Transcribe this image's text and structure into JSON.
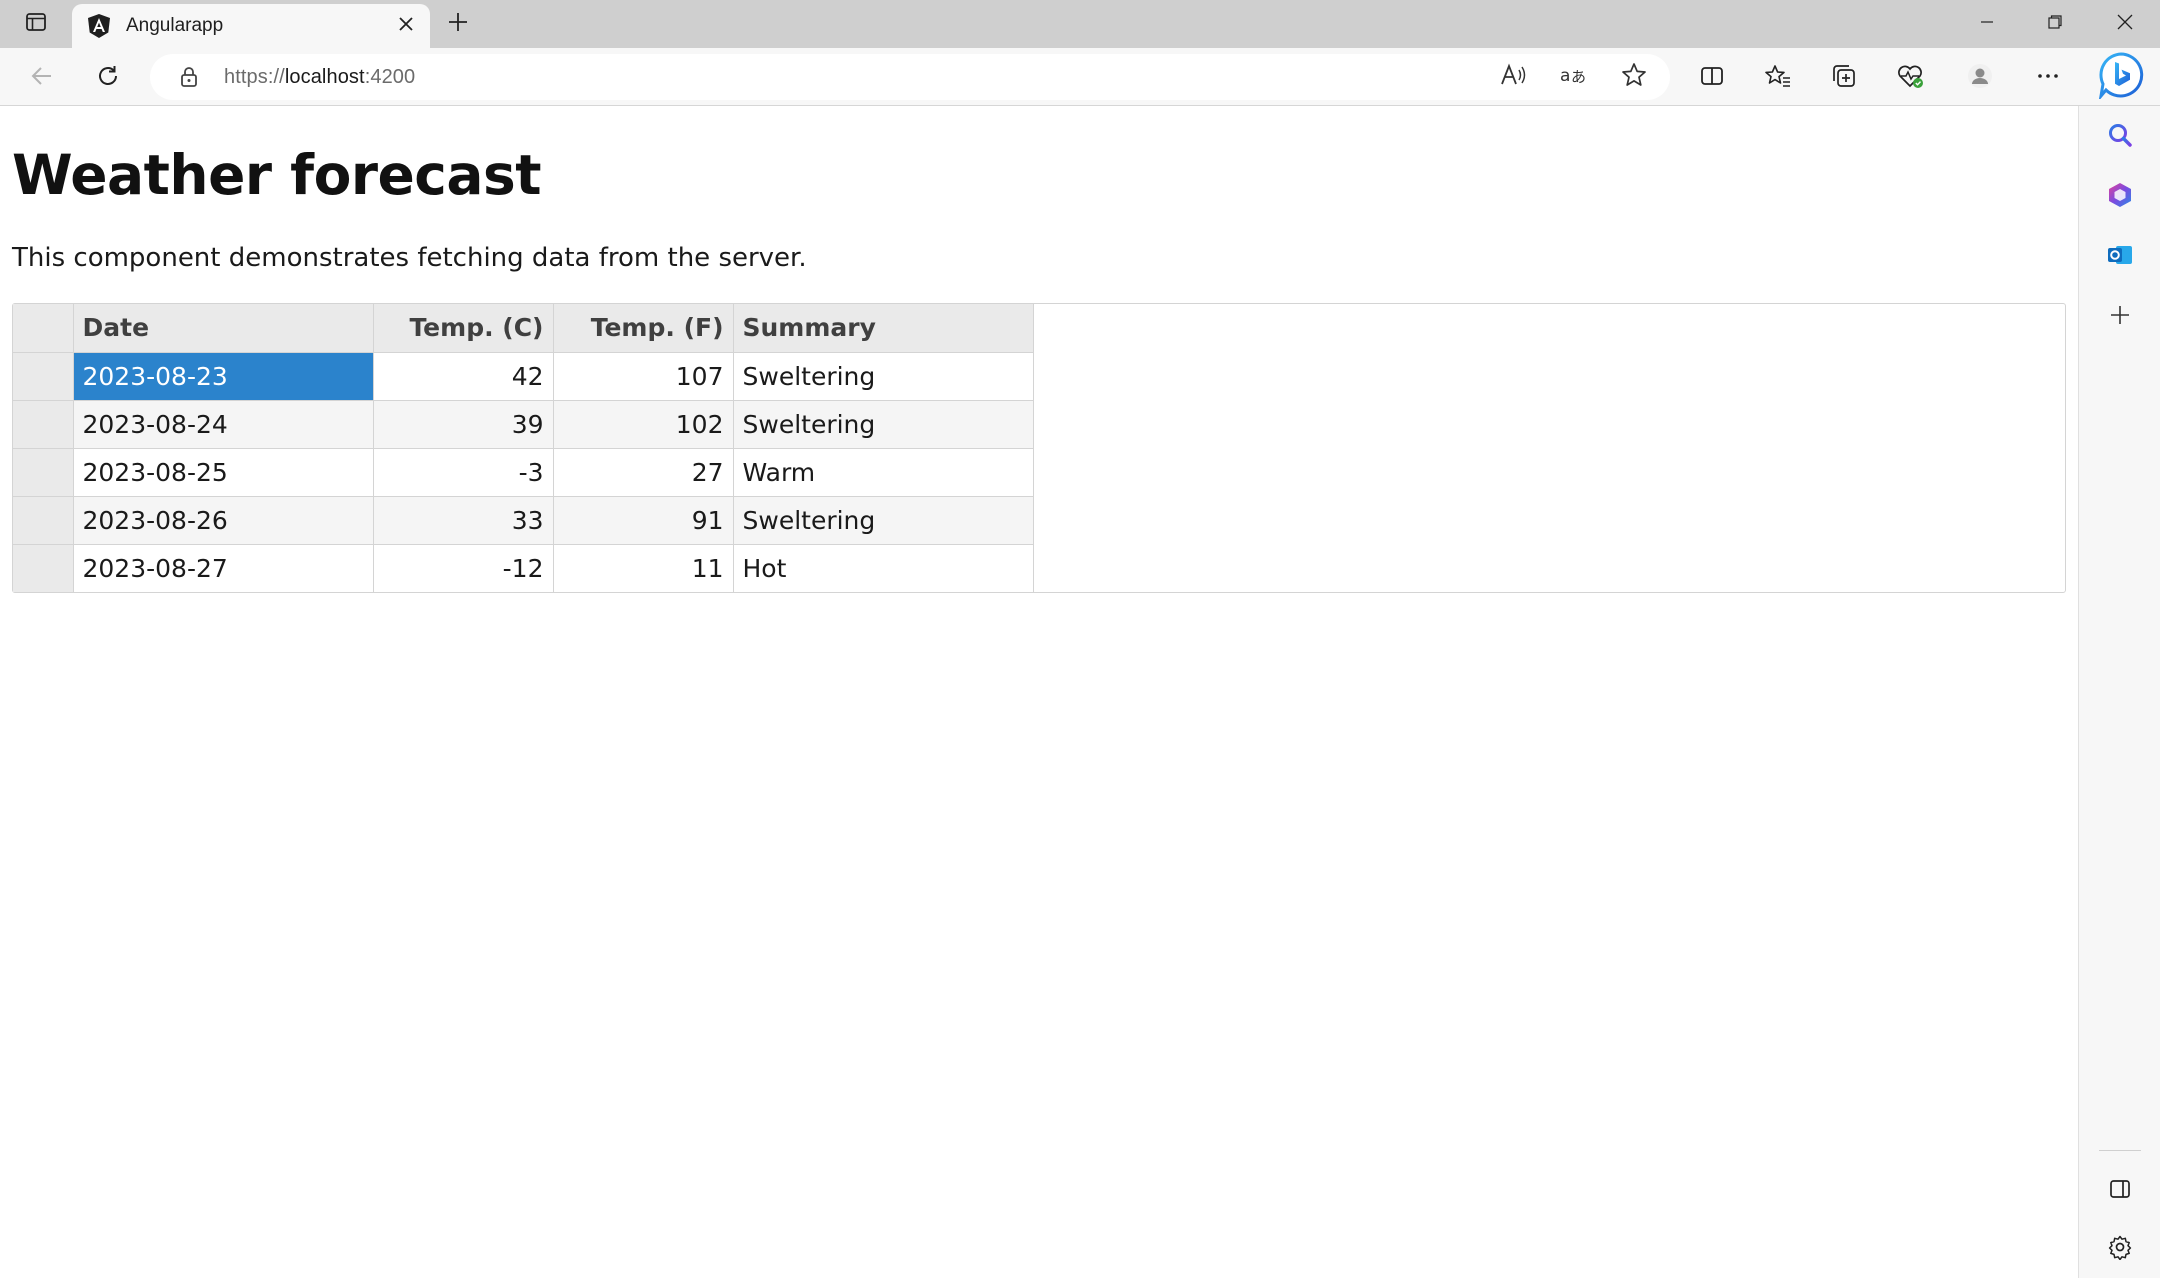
{
  "browser": {
    "tab": {
      "title": "Angularapp",
      "favicon": "angular-logo-icon"
    },
    "address_bar": {
      "scheme": "https://",
      "host": "localhost",
      "port": ":4200"
    },
    "toolbar_icons": [
      "back-icon",
      "refresh-icon",
      "read-aloud-icon",
      "translate-icon",
      "favorite-star-icon",
      "split-screen-icon",
      "favorites-icon",
      "collections-icon",
      "browser-essentials-icon",
      "profile-icon",
      "more-icon"
    ],
    "sidebar_icons": [
      "bing-copilot-icon",
      "search-icon",
      "office-icon",
      "outlook-icon",
      "add-icon",
      "hide-sidebar-icon",
      "settings-icon"
    ],
    "colors": {
      "tab_strip": "#cfcfcf",
      "toolbar": "#f7f7f7",
      "selection": "#2b83cc"
    }
  },
  "page": {
    "title": "Weather forecast",
    "description": "This component demonstrates fetching data from the server."
  },
  "grid": {
    "columns": [
      "Date",
      "Temp. (C)",
      "Temp. (F)",
      "Summary"
    ],
    "rows": [
      {
        "date": "2023-08-23",
        "temp_c": "42",
        "temp_f": "107",
        "summary": "Sweltering"
      },
      {
        "date": "2023-08-24",
        "temp_c": "39",
        "temp_f": "102",
        "summary": "Sweltering"
      },
      {
        "date": "2023-08-25",
        "temp_c": "-3",
        "temp_f": "27",
        "summary": "Warm"
      },
      {
        "date": "2023-08-26",
        "temp_c": "33",
        "temp_f": "91",
        "summary": "Sweltering"
      },
      {
        "date": "2023-08-27",
        "temp_c": "-12",
        "temp_f": "11",
        "summary": "Hot"
      }
    ],
    "selected_cell": {
      "row": 0,
      "column": "Date"
    }
  }
}
